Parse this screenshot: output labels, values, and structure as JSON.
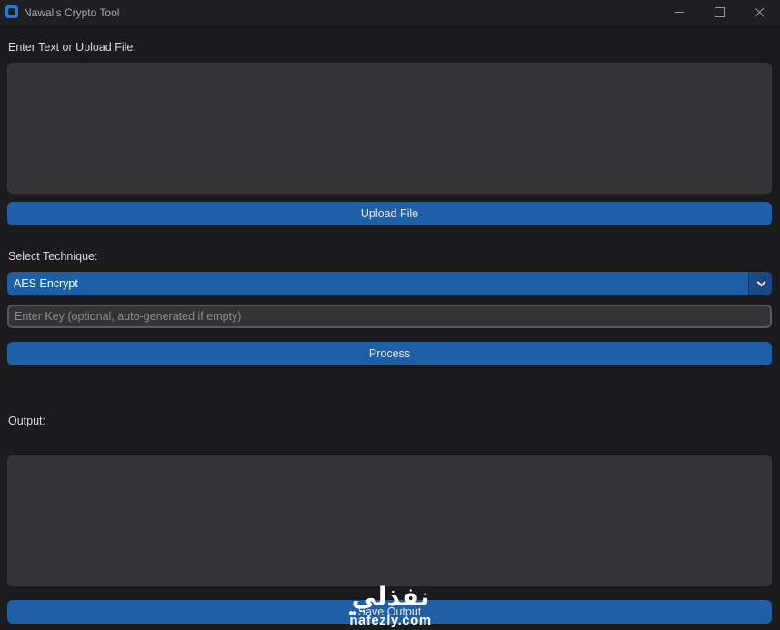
{
  "window": {
    "title": "Nawal's Crypto Tool"
  },
  "input_section": {
    "label": "Enter Text or Upload File:",
    "text_value": "",
    "upload_button": "Upload File"
  },
  "technique_section": {
    "label": "Select Technique:",
    "selected": "AES Encrypt"
  },
  "key_input": {
    "value": "",
    "placeholder": "Enter Key (optional, auto-generated if empty)"
  },
  "process_button": "Process",
  "output_section": {
    "label": "Output:",
    "text_value": "",
    "save_button": "Save Output"
  },
  "watermark": {
    "arabic": "نفذلي",
    "url": "nafezly.com"
  },
  "colors": {
    "background": "#1b1a1d",
    "textbox": "#343336",
    "accent_button": "#1f5fa5",
    "dropdown_arrow": "#1a4a86"
  }
}
